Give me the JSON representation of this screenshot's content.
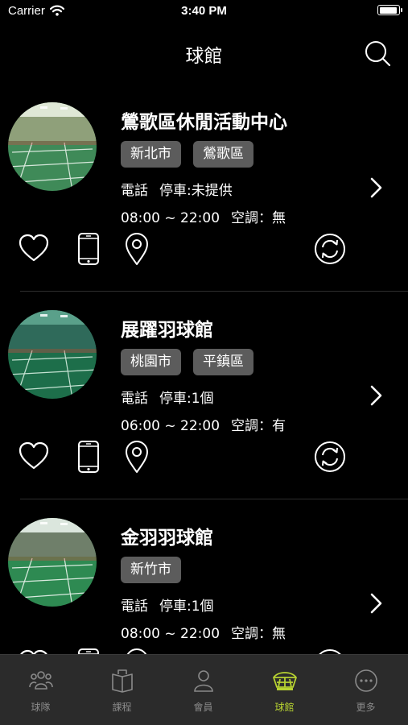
{
  "status_bar": {
    "carrier": "Carrier",
    "time": "3:40 PM"
  },
  "nav": {
    "title": "球館"
  },
  "venues": [
    {
      "name": "鶯歌區休閒活動中心",
      "tags": [
        "新北市",
        "鶯歌區"
      ],
      "phone_label": "電話",
      "parking": "停車:未提供",
      "hours": "08:00 ~ 22:00",
      "ac": "空調：無",
      "photo_icon": "badminton-court-photo"
    },
    {
      "name": "展躍羽球館",
      "tags": [
        "桃園市",
        "平鎮區"
      ],
      "phone_label": "電話",
      "parking": "停車:1個",
      "hours": "06:00 ~ 22:00",
      "ac": "空調：有",
      "photo_icon": "badminton-court-photo"
    },
    {
      "name": "金羽羽球館",
      "tags": [
        "新竹市"
      ],
      "phone_label": "電話",
      "parking": "停車:1個",
      "hours": "08:00 ~ 22:00",
      "ac": "空調：無",
      "photo_icon": "badminton-court-photo"
    }
  ],
  "tab_bar": {
    "active": 3,
    "accent_color": "#b7d231",
    "items": [
      {
        "label": "球隊",
        "icon": "team-icon"
      },
      {
        "label": "課程",
        "icon": "book-icon"
      },
      {
        "label": "會員",
        "icon": "member-icon"
      },
      {
        "label": "球館",
        "icon": "venue-icon"
      },
      {
        "label": "更多",
        "icon": "more-icon"
      }
    ]
  }
}
